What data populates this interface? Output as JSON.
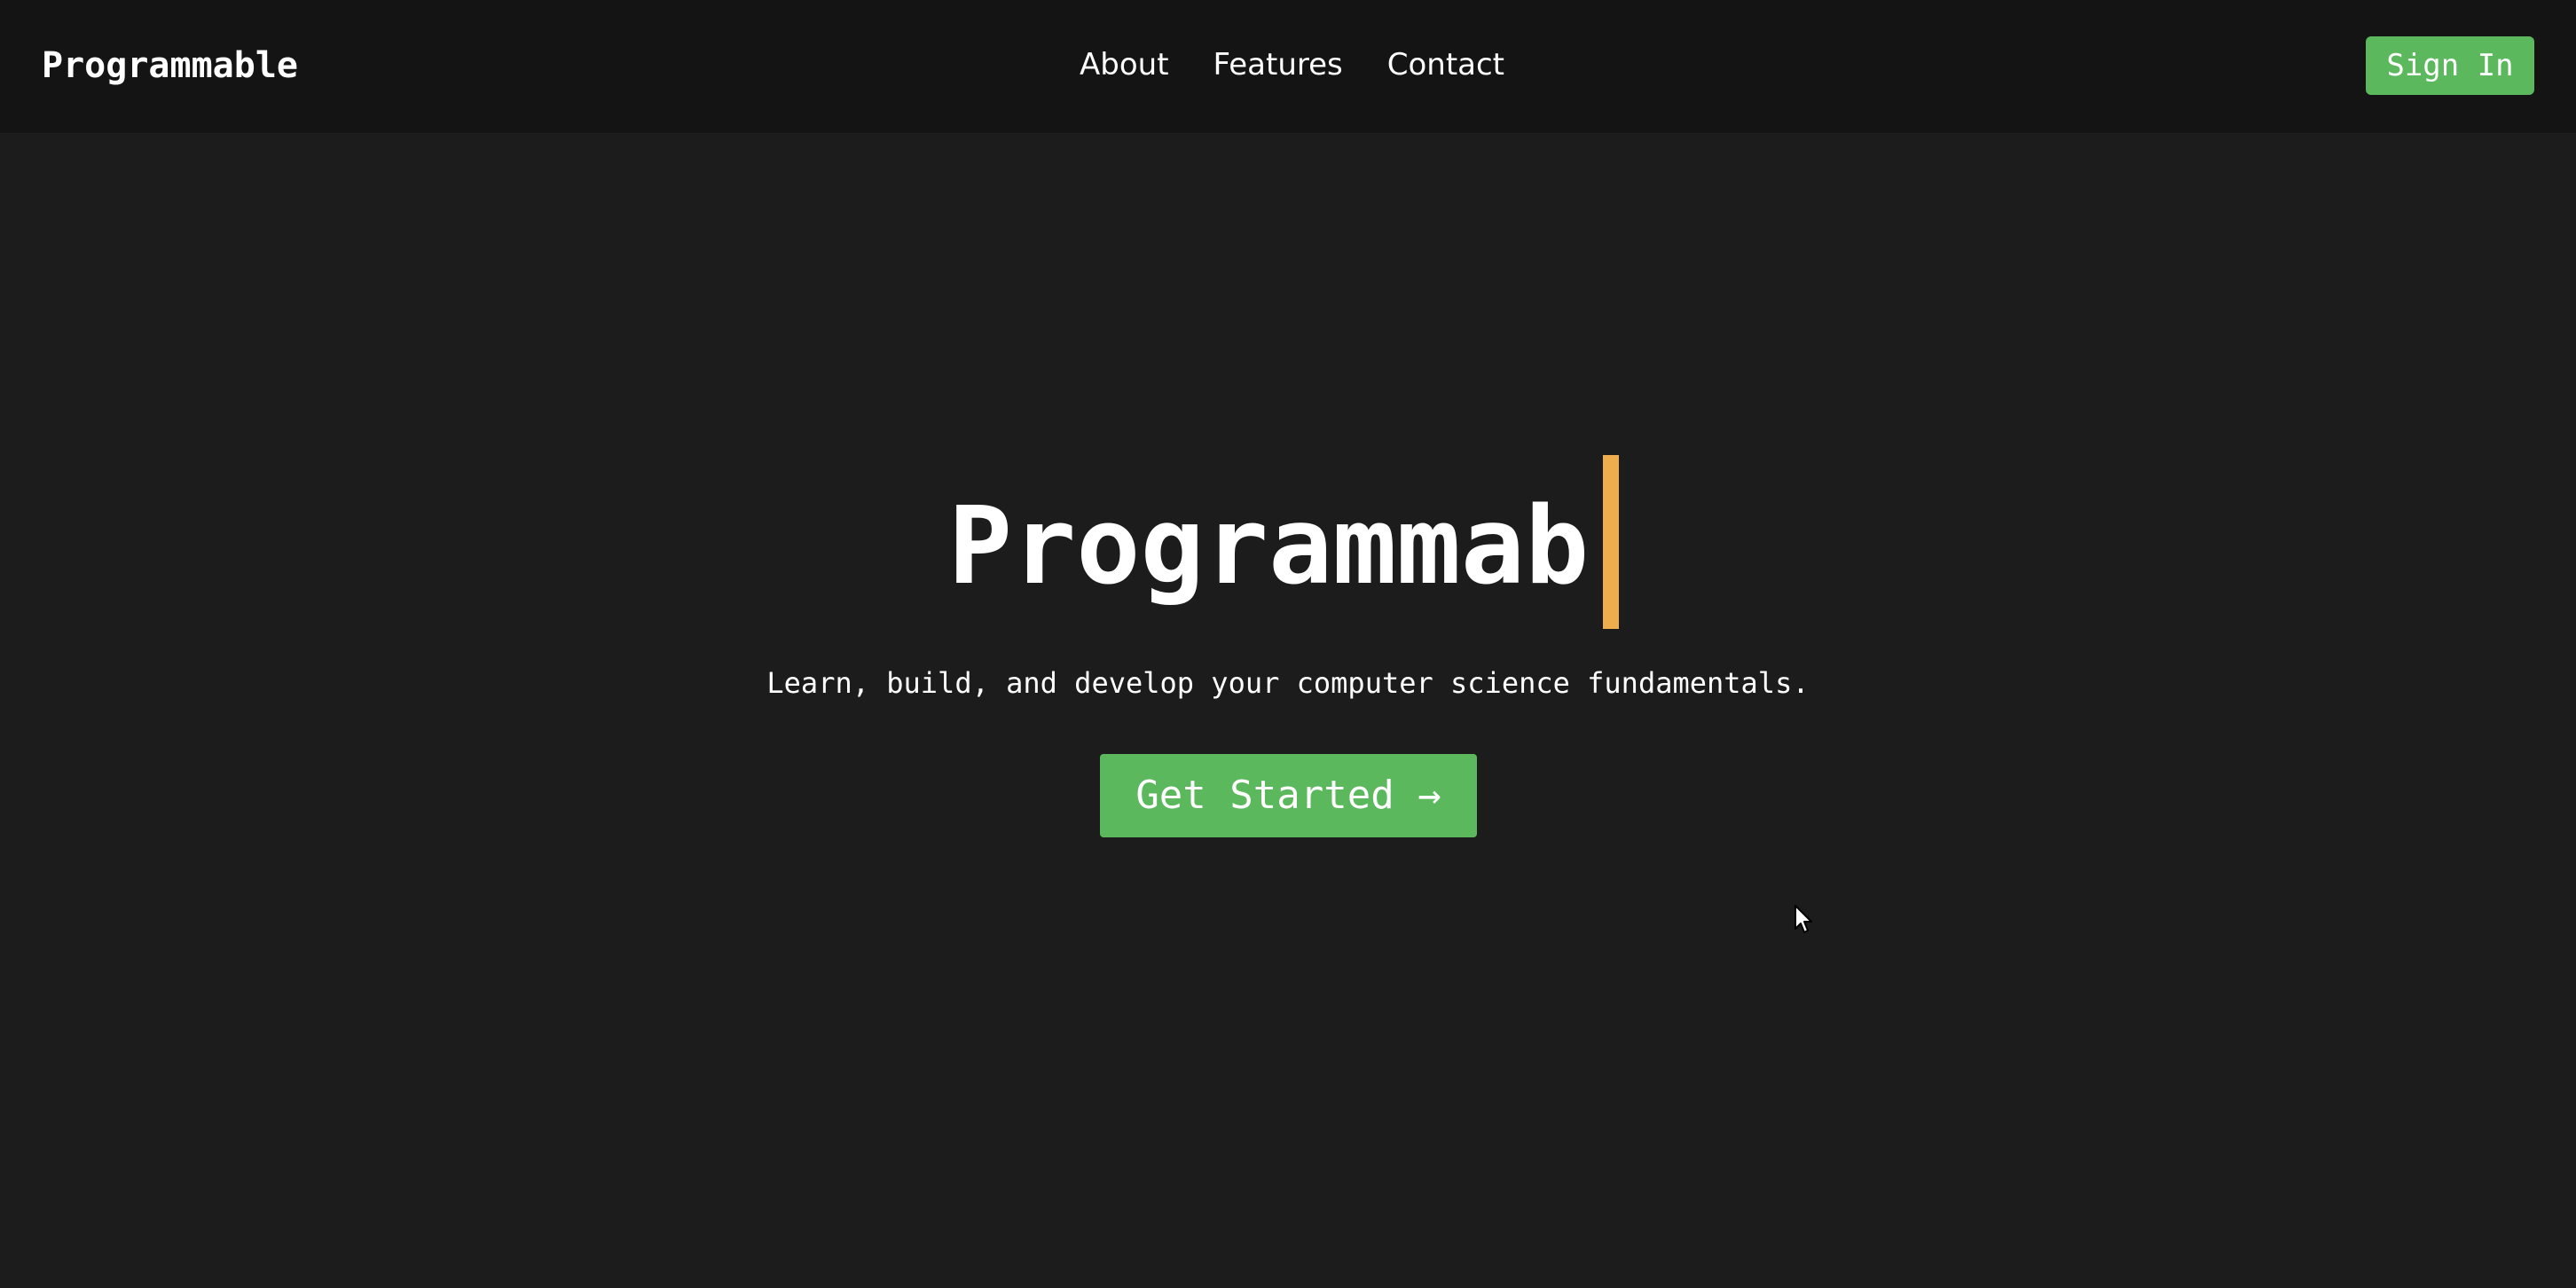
{
  "header": {
    "brand": "Programmable",
    "nav": [
      {
        "label": "About"
      },
      {
        "label": "Features"
      },
      {
        "label": "Contact"
      }
    ],
    "sign_in_label": "Sign In"
  },
  "hero": {
    "title": "Programmab",
    "subtitle": "Learn, build, and develop your computer science fundamentals.",
    "cta_label": "Get Started →"
  },
  "colors": {
    "background": "#1c1c1c",
    "navbar": "#141414",
    "accent_green": "#5cb85c",
    "caret_orange": "#f0ad4e",
    "text": "#ffffff"
  },
  "icons": {
    "cursor": "mouse-pointer-icon",
    "cta_arrow": "arrow-right-icon"
  }
}
